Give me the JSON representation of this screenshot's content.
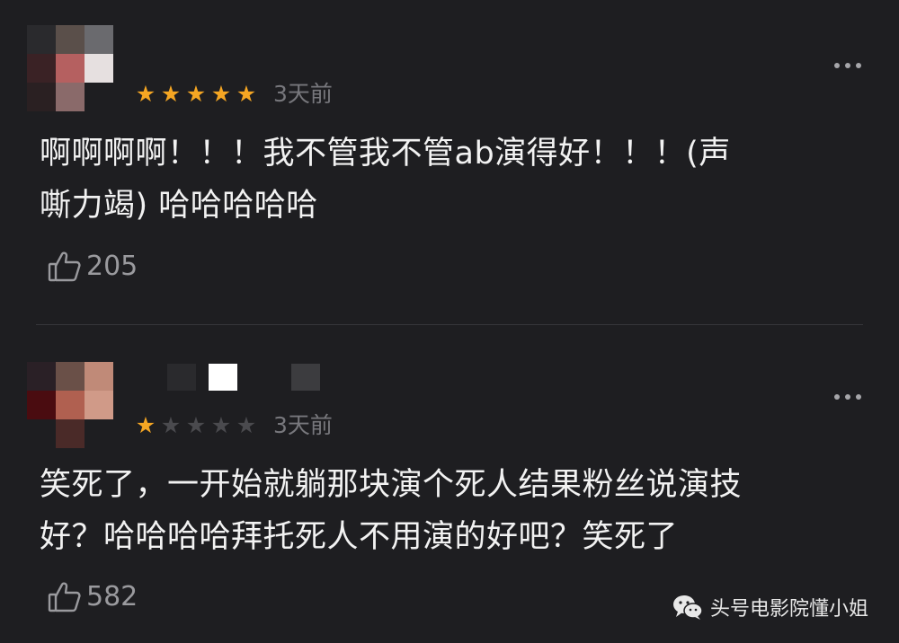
{
  "comments": [
    {
      "rating": 5,
      "stars": [
        "★",
        "★",
        "★",
        "★",
        "★"
      ],
      "time": "3天前",
      "text_lines": [
        "啊啊啊啊！！！我不管我不管ab演得好！！！(声",
        "嘶力竭) 哈哈哈哈哈"
      ],
      "likes": "205",
      "avatar_pixels": [
        "#2a2a2d",
        "#5a4f4a",
        "#6a6a6e",
        "#3a2225",
        "#b56060",
        "#e6e0e0",
        "#2a2022",
        "#8a6a6a",
        "#1e1e21"
      ],
      "name_blur_pixels": []
    },
    {
      "rating": 1,
      "stars": [
        "★",
        "★",
        "★",
        "★",
        "★"
      ],
      "time": "3天前",
      "text_lines": [
        "笑死了，一开始就躺那块演个死人结果粉丝说演技",
        "好？哈哈哈哈拜托死人不用演的好吧？笑死了"
      ],
      "likes": "582",
      "avatar_pixels": [
        "#2a2026",
        "#6a5048",
        "#c08a78",
        "#4a0c10",
        "#b06050",
        "#d09a88",
        "#1e1e21",
        "#4a2a28",
        "#1e1e21"
      ],
      "name_blur_pixels": [
        "#2a2a2d",
        "#ffffff",
        "#1e1e21",
        "#3c3c3f"
      ]
    }
  ],
  "watermark": {
    "icon": "wechat-icon",
    "label": "头号电影院懂小姐"
  },
  "colors": {
    "background": "#1e1e21",
    "star_on": "#f5a623",
    "star_off": "#4a4a4e",
    "muted": "#77777c"
  }
}
